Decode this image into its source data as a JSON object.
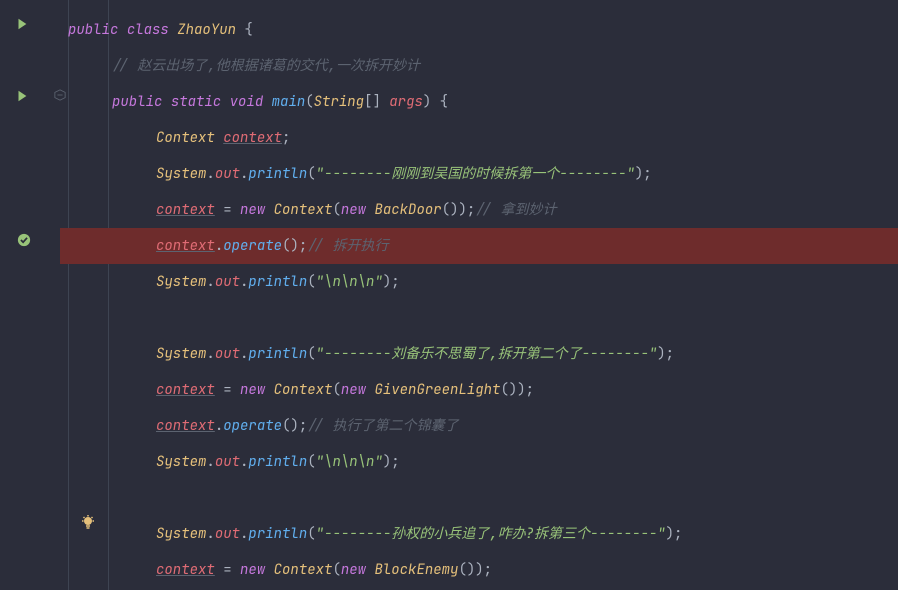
{
  "code": {
    "line1": {
      "kw_public": "public",
      "kw_class": "class",
      "class_name": "ZhaoYun",
      "brace": " {"
    },
    "line2": {
      "comment": "// 赵云出场了,他根据诸葛的交代,一次拆开妙计"
    },
    "line3": {
      "kw_public": "public",
      "kw_static": "static",
      "kw_void": "void",
      "method": "main",
      "lp": "(",
      "type": "String",
      "brk": "[] ",
      "arg": "args",
      "rp": ")",
      "brace": " {"
    },
    "line4": {
      "type": "Context",
      "var": "context",
      "semi": ";"
    },
    "line5": {
      "sys": "System",
      "dot1": ".",
      "out": "out",
      "dot2": ".",
      "println": "println",
      "lp": "(",
      "str": "\"--------刚刚到吴国的时候拆第一个--------\"",
      "rp": ")",
      "semi": ";"
    },
    "line6": {
      "var": "context",
      "eq": " = ",
      "kw_new": "new",
      "sp": " ",
      "ctx": "Context",
      "lp": "(",
      "kw_new2": "new",
      "sp2": " ",
      "cls": "BackDoor",
      "lp2": "(",
      "rp2": ")",
      "rp": ")",
      "semi": ";",
      "cmt": "// 拿到妙计"
    },
    "line7": {
      "var": "context",
      "dot": ".",
      "method": "operate",
      "lp": "(",
      "rp": ")",
      "semi": ";",
      "cmt": "// 拆开执行"
    },
    "line8": {
      "sys": "System",
      "dot1": ".",
      "out": "out",
      "dot2": ".",
      "println": "println",
      "lp": "(",
      "str": "\"\\n\\n\\n\"",
      "rp": ")",
      "semi": ";"
    },
    "line10": {
      "sys": "System",
      "dot1": ".",
      "out": "out",
      "dot2": ".",
      "println": "println",
      "lp": "(",
      "str": "\"--------刘备乐不思蜀了,拆开第二个了--------\"",
      "rp": ")",
      "semi": ";"
    },
    "line11": {
      "var": "context",
      "eq": " = ",
      "kw_new": "new",
      "sp": " ",
      "ctx": "Context",
      "lp": "(",
      "kw_new2": "new",
      "sp2": " ",
      "cls": "GivenGreenLight",
      "lp2": "(",
      "rp2": ")",
      "rp": ")",
      "semi": ";"
    },
    "line12": {
      "var": "context",
      "dot": ".",
      "method": "operate",
      "lp": "(",
      "rp": ")",
      "semi": ";",
      "cmt": "// 执行了第二个锦囊了"
    },
    "line13": {
      "sys": "System",
      "dot1": ".",
      "out": "out",
      "dot2": ".",
      "println": "println",
      "lp": "(",
      "str": "\"\\n\\n\\n\"",
      "rp": ")",
      "semi": ";"
    },
    "line15": {
      "sys": "System",
      "dot1": ".",
      "out": "out",
      "dot2": ".",
      "println": "println",
      "lp": "(",
      "str": "\"--------孙权的小兵追了,咋办?拆第三个--------\"",
      "rp": ")",
      "semi": ";"
    },
    "line16": {
      "var": "context",
      "eq": " = ",
      "kw_new": "new",
      "sp": " ",
      "ctx": "Context",
      "lp": "(",
      "kw_new2": "new",
      "sp2": " ",
      "cls": "BlockEnemy",
      "lp2": "(",
      "rp2": ")",
      "rp": ")",
      "semi": ";"
    }
  },
  "icons": {
    "run": "run-icon",
    "check": "breakpoint-check-icon",
    "bulb": "intention-bulb-icon",
    "fold": "fold-icon"
  }
}
